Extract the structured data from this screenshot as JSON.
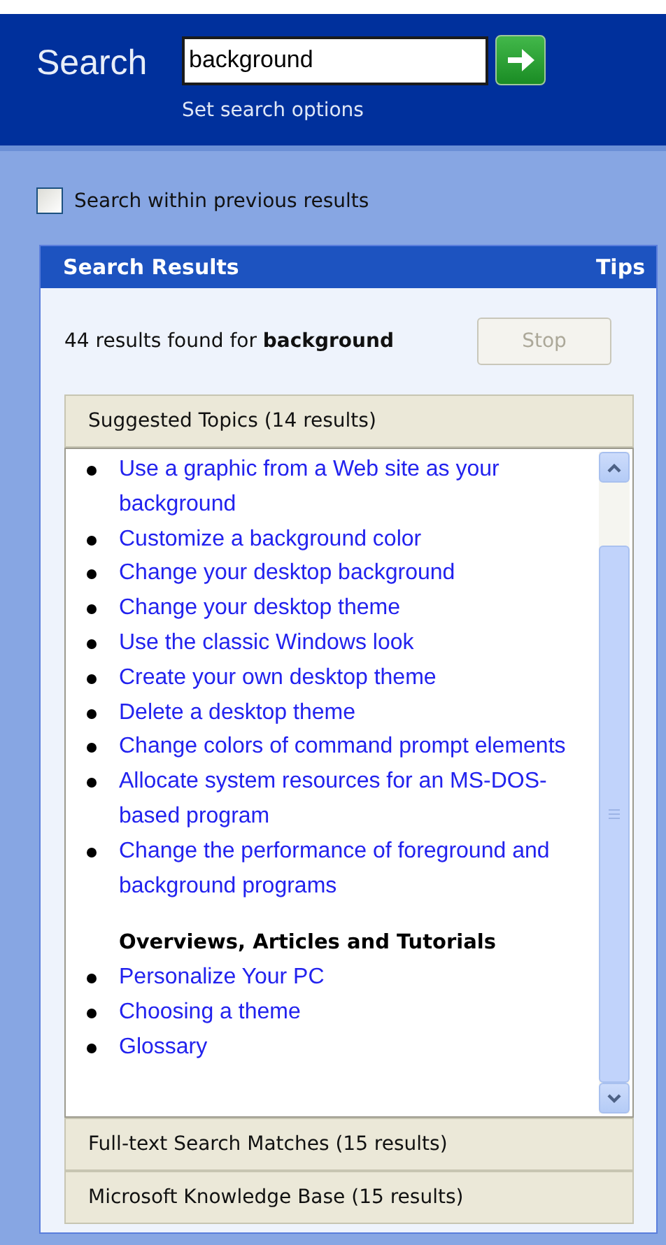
{
  "header": {
    "title": "Search",
    "query": "background",
    "options_link": "Set search options"
  },
  "search_within": {
    "label": "Search within previous results",
    "checked": false
  },
  "results_panel": {
    "title": "Search Results",
    "tips": "Tips",
    "summary": "44 results found for **background**",
    "stop_button": {
      "label": "Stop",
      "disabled": true
    },
    "sections": [
      {
        "title": "Suggested Topics (14 results)",
        "expanded": true,
        "items": [
          {
            "kind": "link",
            "text": "Use a graphic from a Web site as your background"
          },
          {
            "kind": "link",
            "text": "Customize a background color"
          },
          {
            "kind": "link",
            "text": "Change your desktop background"
          },
          {
            "kind": "link",
            "text": "Change your desktop theme"
          },
          {
            "kind": "link",
            "text": "Use the classic Windows look"
          },
          {
            "kind": "link",
            "text": "Create your own desktop theme"
          },
          {
            "kind": "link",
            "text": "Delete a desktop theme"
          },
          {
            "kind": "link",
            "text": "Change colors of command prompt elements"
          },
          {
            "kind": "link",
            "text": "Allocate system resources for an MS-DOS-based program"
          },
          {
            "kind": "link",
            "text": "Change the performance of foreground and background programs"
          },
          {
            "kind": "heading",
            "text": "Overviews, Articles and Tutorials"
          },
          {
            "kind": "link",
            "text": "Personalize Your PC"
          },
          {
            "kind": "link",
            "text": "Choosing a theme"
          },
          {
            "kind": "link",
            "text": "Glossary"
          }
        ]
      },
      {
        "title": "Full-text Search Matches (15 results)",
        "expanded": false
      },
      {
        "title": "Microsoft Knowledge Base (15 results)",
        "expanded": false
      }
    ]
  }
}
